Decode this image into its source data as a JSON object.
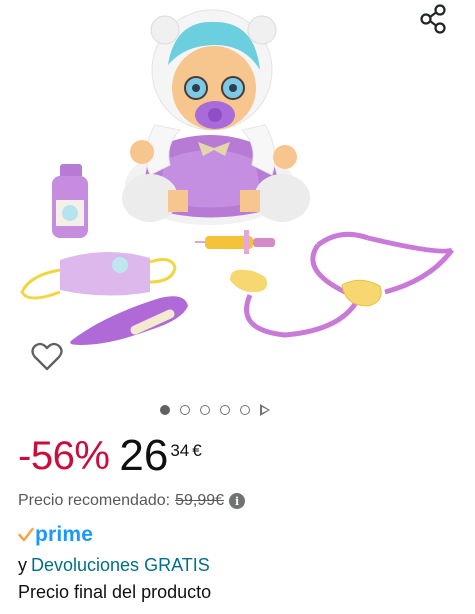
{
  "product_image": {
    "alt": "Muñeca bebé con kit de médico",
    "carousel_count": 5,
    "carousel_active": 1
  },
  "icons": {
    "share": "share-icon",
    "wishlist": "heart-outline-icon",
    "info": "info-icon",
    "prime_check": "check-icon",
    "play": "play-icon"
  },
  "price": {
    "discount": "-56%",
    "whole": "26",
    "fraction": "34",
    "currency": "€"
  },
  "rrp": {
    "label": "Precio recomendado:",
    "value": "59,99€",
    "info_glyph": "i"
  },
  "prime": {
    "label": "prime"
  },
  "returns": {
    "prefix": "y",
    "link": "Devoluciones GRATIS"
  },
  "final_price_label": "Precio final del producto",
  "colors": {
    "discount": "#cc0c39",
    "prime": "#1a98ff",
    "prime_check": "#f3a847",
    "link": "#007185",
    "muted": "#565959"
  }
}
